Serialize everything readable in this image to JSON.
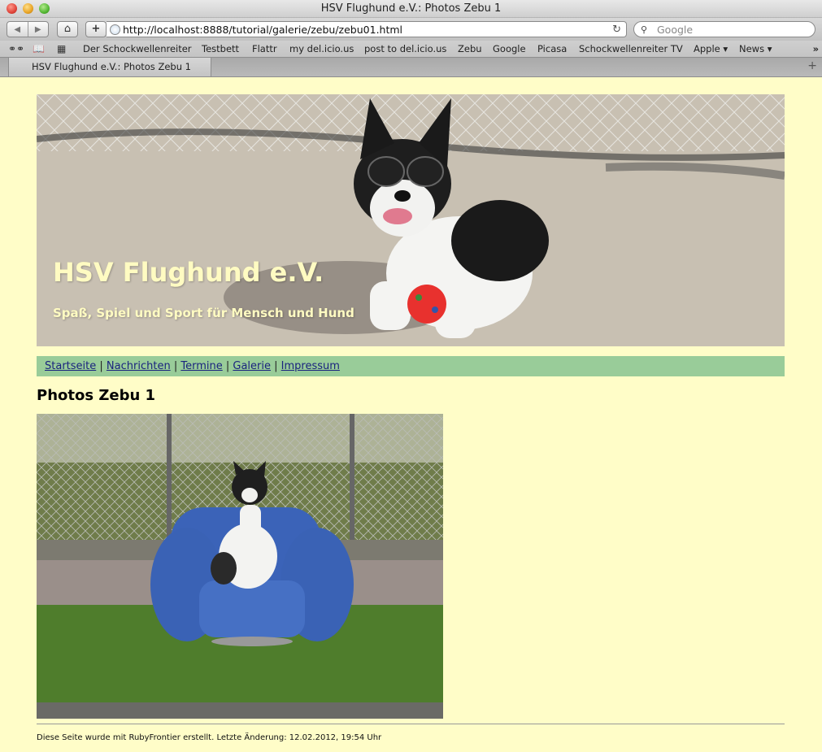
{
  "window": {
    "title": "HSV Flughund e.V.: Photos Zebu 1"
  },
  "toolbar": {
    "back_icon": "◀",
    "forward_icon": "▶",
    "home_icon": "⌂",
    "add_icon": "+",
    "url": "http://localhost:8888/tutorial/galerie/zebu/zebu01.html",
    "reload_icon": "↻",
    "search_placeholder": "Google"
  },
  "bookmarks": {
    "items": [
      "Der Schockwellenreiter",
      "Testbett",
      "Flattr",
      "my del.icio.us",
      "post to del.icio.us",
      "Zebu",
      "Google",
      "Picasa",
      "Schockwellenreiter TV",
      "Apple ▾",
      "News ▾"
    ],
    "more": "»"
  },
  "tabs": [
    {
      "label": "HSV Flughund e.V.: Photos Zebu 1"
    }
  ],
  "header": {
    "title": "HSV Flughund e.V.",
    "subtitle": "Spaß, Spiel und Sport für Mensch und Hund"
  },
  "nav": {
    "links": [
      "Startseite",
      "Nachrichten",
      "Termine",
      "Galerie",
      "Impressum"
    ],
    "separator": "|"
  },
  "main": {
    "title": "Photos Zebu 1"
  },
  "footer": {
    "text": "Diese Seite wurde mit RubyFrontier erstellt. Letzte Änderung: 12.02.2012, 19:54 Uhr"
  },
  "colors": {
    "page_bg": "#fffdc8",
    "nav_bg": "#99cc99",
    "header_text": "#fffbc2",
    "link": "#1a237e"
  }
}
